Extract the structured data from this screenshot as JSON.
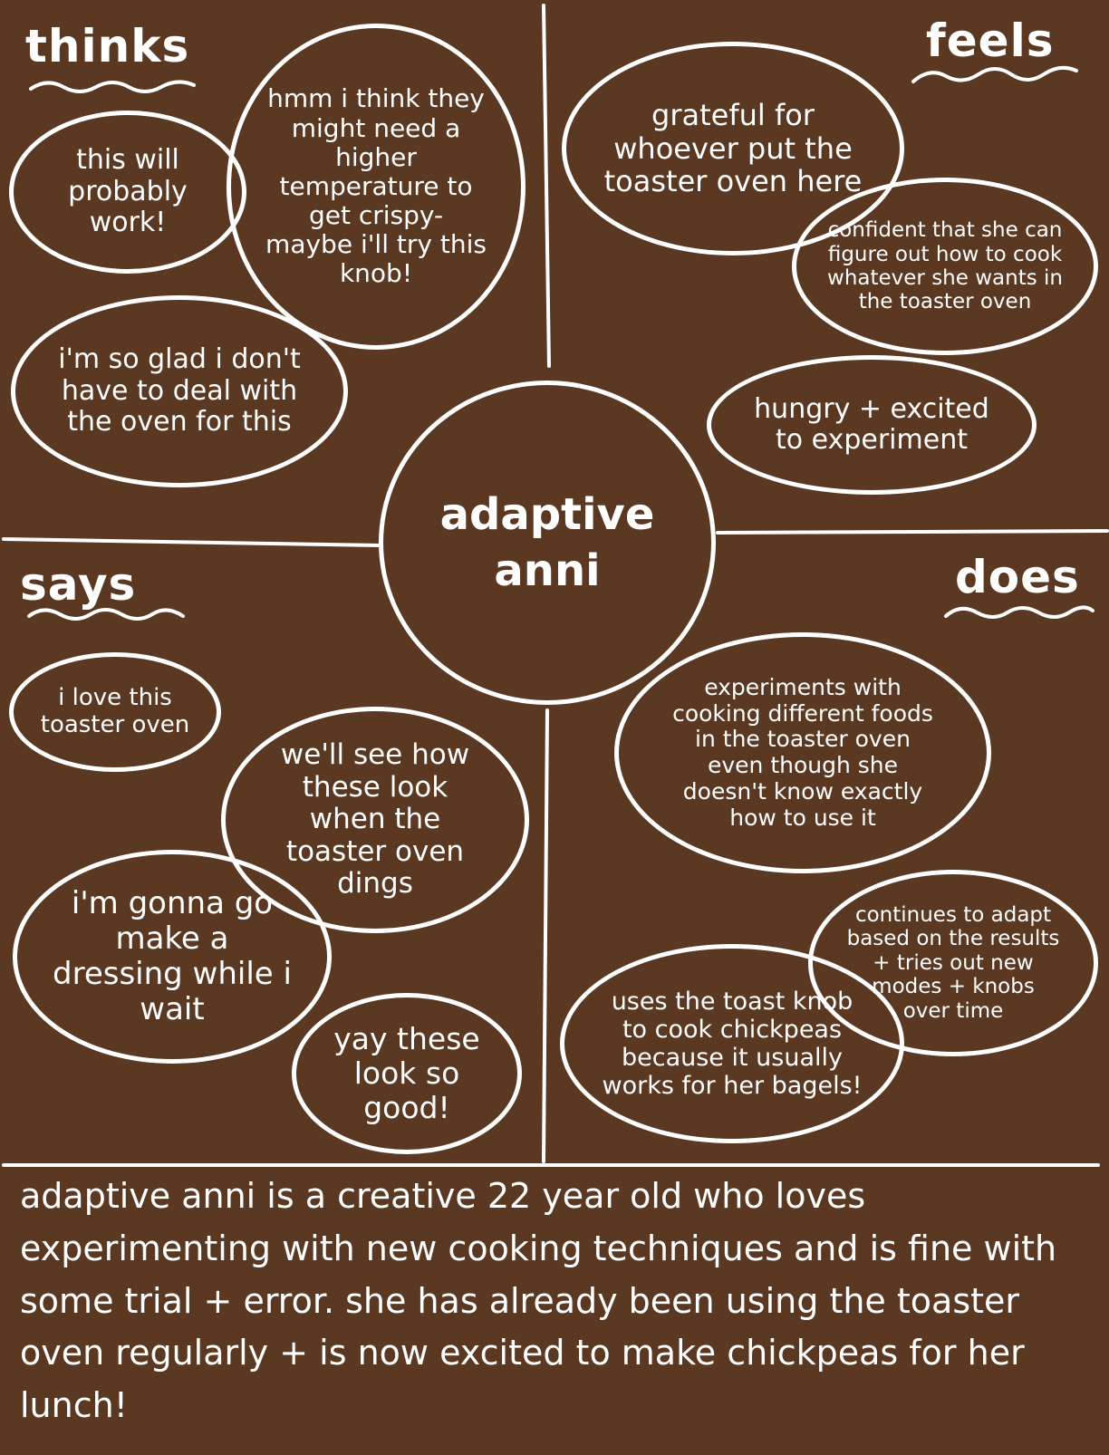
{
  "persona": {
    "name": "adaptive\nanni"
  },
  "quadrants": {
    "thinks": {
      "label": "thinks",
      "bubbles": [
        "this will probably work!",
        "hmm i think they might need a higher temperature to get crispy- maybe i'll try this knob!",
        "i'm so glad i don't have to deal with the oven for this"
      ]
    },
    "feels": {
      "label": "feels",
      "bubbles": [
        "grateful for whoever put the toaster oven here",
        "confident that she can figure out how to cook whatever she wants in the toaster oven",
        "hungry + excited to experiment"
      ]
    },
    "says": {
      "label": "says",
      "bubbles": [
        "i love this toaster oven",
        "we'll see how these look when the toaster oven dings",
        "i'm gonna go make a dressing while i wait",
        "yay these look so good!"
      ]
    },
    "does": {
      "label": "does",
      "bubbles": [
        "experiments with cooking different foods in the toaster oven even though she doesn't know exactly how to use it",
        "continues to adapt based on the results + tries out new modes + knobs over time",
        "uses the toast knob to cook chickpeas because it usually works for her bagels!"
      ]
    }
  },
  "summary": "adaptive anni is a creative 22 year old who loves experimenting with new cooking techniques and is fine with some trial + error. she has already been using the toaster oven regularly + is now excited to make chickpeas for her lunch!",
  "colors": {
    "background": "#5a3822",
    "ink": "#ffffff"
  }
}
